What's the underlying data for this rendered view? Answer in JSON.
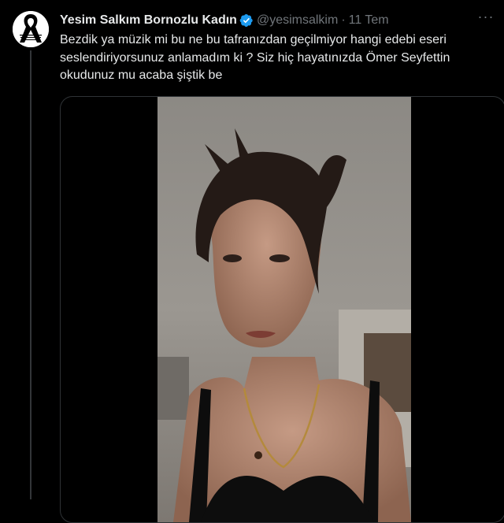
{
  "tweet": {
    "display_name": "Yesim Salkım Bornozlu Kadın",
    "handle": "@yesimsalkim",
    "separator": "·",
    "date": "11 Tem",
    "more_label": "···",
    "text_lines": [
      "Bezdik ya müzik mi bu ne bu tafranızdan geçilmiyor hangi edebi eseri",
      "seslendiriyorsunuz anlamadım ki ? Siz hiç hayatınızda Ömer Seyfettin",
      "okudunuz mu acaba şiştik be"
    ],
    "verified": true,
    "colors": {
      "accent": "#1d9bf0",
      "background": "#000000",
      "text": "#e7e9ea",
      "muted": "#71767b"
    }
  }
}
